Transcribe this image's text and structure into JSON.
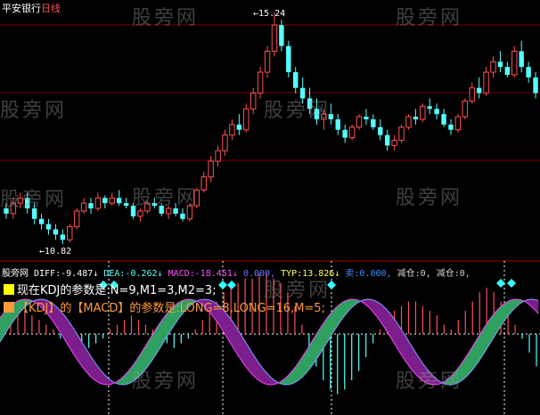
{
  "title": {
    "name": "平安银行",
    "period": "日线"
  },
  "colors": {
    "up": "#ff5050",
    "down": "#54ffff",
    "bg": "#000000",
    "grid": "#7a0000"
  },
  "chart_data": {
    "type": "candlestick",
    "price_high_label": "15.24",
    "price_low_label": "10.82",
    "candles": [
      [
        11.5,
        11.6,
        11.3,
        11.4
      ],
      [
        11.4,
        11.7,
        11.3,
        11.6
      ],
      [
        11.6,
        11.8,
        11.5,
        11.7
      ],
      [
        11.7,
        11.8,
        11.4,
        11.5
      ],
      [
        11.5,
        11.6,
        11.2,
        11.3
      ],
      [
        11.3,
        11.4,
        11.1,
        11.2
      ],
      [
        11.2,
        11.3,
        11.0,
        11.1
      ],
      [
        11.1,
        11.2,
        10.9,
        11.0
      ],
      [
        11.0,
        11.1,
        10.82,
        10.9
      ],
      [
        10.9,
        11.2,
        10.85,
        11.15
      ],
      [
        11.15,
        11.5,
        11.1,
        11.45
      ],
      [
        11.45,
        11.7,
        11.4,
        11.6
      ],
      [
        11.6,
        11.7,
        11.4,
        11.5
      ],
      [
        11.5,
        11.8,
        11.45,
        11.7
      ],
      [
        11.7,
        11.75,
        11.5,
        11.6
      ],
      [
        11.6,
        11.8,
        11.55,
        11.7
      ],
      [
        11.7,
        11.85,
        11.55,
        11.6
      ],
      [
        11.6,
        11.7,
        11.5,
        11.55
      ],
      [
        11.55,
        11.6,
        11.3,
        11.35
      ],
      [
        11.35,
        11.5,
        11.25,
        11.45
      ],
      [
        11.45,
        11.65,
        11.4,
        11.6
      ],
      [
        11.6,
        11.7,
        11.5,
        11.55
      ],
      [
        11.55,
        11.6,
        11.35,
        11.4
      ],
      [
        11.4,
        11.55,
        11.3,
        11.5
      ],
      [
        11.5,
        11.6,
        11.35,
        11.4
      ],
      [
        11.4,
        11.5,
        11.25,
        11.3
      ],
      [
        11.3,
        11.6,
        11.25,
        11.55
      ],
      [
        11.55,
        11.9,
        11.5,
        11.85
      ],
      [
        11.85,
        12.2,
        11.8,
        12.1
      ],
      [
        12.1,
        12.5,
        12.0,
        12.4
      ],
      [
        12.4,
        12.7,
        12.3,
        12.6
      ],
      [
        12.6,
        13.0,
        12.5,
        12.9
      ],
      [
        12.9,
        13.2,
        12.8,
        13.1
      ],
      [
        13.1,
        13.3,
        12.9,
        13.0
      ],
      [
        13.0,
        13.5,
        12.95,
        13.4
      ],
      [
        13.4,
        13.8,
        13.3,
        13.7
      ],
      [
        13.7,
        14.2,
        13.6,
        14.1
      ],
      [
        14.1,
        14.6,
        14.0,
        14.5
      ],
      [
        14.5,
        15.24,
        14.4,
        15.0
      ],
      [
        15.0,
        15.1,
        14.5,
        14.6
      ],
      [
        14.6,
        14.7,
        14.0,
        14.1
      ],
      [
        14.1,
        14.2,
        13.7,
        13.8
      ],
      [
        13.8,
        14.0,
        13.5,
        13.6
      ],
      [
        13.6,
        13.8,
        13.3,
        13.4
      ],
      [
        13.4,
        13.6,
        13.1,
        13.2
      ],
      [
        13.2,
        13.4,
        13.0,
        13.3
      ],
      [
        13.3,
        13.5,
        13.1,
        13.2
      ],
      [
        13.2,
        13.3,
        12.9,
        13.0
      ],
      [
        13.0,
        13.1,
        12.75,
        12.85
      ],
      [
        12.85,
        13.1,
        12.8,
        13.05
      ],
      [
        13.05,
        13.3,
        13.0,
        13.25
      ],
      [
        13.25,
        13.4,
        13.1,
        13.2
      ],
      [
        13.2,
        13.3,
        13.0,
        13.05
      ],
      [
        13.05,
        13.2,
        12.8,
        12.9
      ],
      [
        12.9,
        13.0,
        12.6,
        12.7
      ],
      [
        12.7,
        12.9,
        12.6,
        12.8
      ],
      [
        12.8,
        13.1,
        12.75,
        13.05
      ],
      [
        13.05,
        13.3,
        13.0,
        13.25
      ],
      [
        13.25,
        13.4,
        13.1,
        13.2
      ],
      [
        13.2,
        13.5,
        13.15,
        13.45
      ],
      [
        13.45,
        13.6,
        13.3,
        13.4
      ],
      [
        13.4,
        13.5,
        13.2,
        13.3
      ],
      [
        13.3,
        13.4,
        13.05,
        13.1
      ],
      [
        13.1,
        13.2,
        12.9,
        13.0
      ],
      [
        13.0,
        13.3,
        12.95,
        13.25
      ],
      [
        13.25,
        13.6,
        13.2,
        13.55
      ],
      [
        13.55,
        13.9,
        13.5,
        13.8
      ],
      [
        13.8,
        14.0,
        13.6,
        13.7
      ],
      [
        13.7,
        14.2,
        13.65,
        14.1
      ],
      [
        14.1,
        14.4,
        14.0,
        14.3
      ],
      [
        14.3,
        14.5,
        14.1,
        14.2
      ],
      [
        14.2,
        14.3,
        14.0,
        14.05
      ],
      [
        14.05,
        14.6,
        14.0,
        14.5
      ],
      [
        14.5,
        14.7,
        14.1,
        14.2
      ],
      [
        14.2,
        14.3,
        13.9,
        14.0
      ],
      [
        14.0,
        14.1,
        13.6,
        13.7
      ]
    ],
    "indicator_sticks": [
      2,
      3,
      4,
      5,
      4,
      3,
      2,
      1,
      -1,
      -2,
      -3,
      -4,
      -3,
      -2,
      -1,
      1,
      2,
      3,
      4,
      3,
      2,
      1,
      -1,
      -2,
      -3,
      -2,
      -1,
      1,
      3,
      5,
      7,
      9,
      10,
      11,
      12,
      12,
      13,
      13,
      12,
      11,
      9,
      6,
      2,
      -3,
      -7,
      -10,
      -12,
      -13,
      -12,
      -10,
      -8,
      -5,
      -2,
      1,
      3,
      5,
      6,
      7,
      7,
      6,
      5,
      4,
      2,
      1,
      3,
      5,
      7,
      9,
      10,
      9,
      7,
      5,
      2,
      -1,
      -4,
      -7
    ]
  },
  "indicator": {
    "source": "股旁网",
    "diff_label": "DIFF:",
    "diff_value": "-9.487",
    "dea_label": "DEA:",
    "dea_value": "-0.262",
    "macd_label": "MACD:",
    "macd_value": "-18.451",
    "extra_value": "0.000",
    "typ_label": "TYP:",
    "typ_value": "13.826",
    "sell_label": "卖:",
    "sell_value": "0.000",
    "reduce1_label": "减仓:",
    "reduce1_value": "0,",
    "reduce2_label": "减仓:",
    "reduce2_value": "0,"
  },
  "info_lines": {
    "kdj_params": "现在KDJ的参数是:N=9,M1=3,M2=3;",
    "kdj_macd_params": "【KDJ】的【MACD】的参数是:LONG=8,LONG=16,M=5;"
  },
  "watermark": "股旁网"
}
